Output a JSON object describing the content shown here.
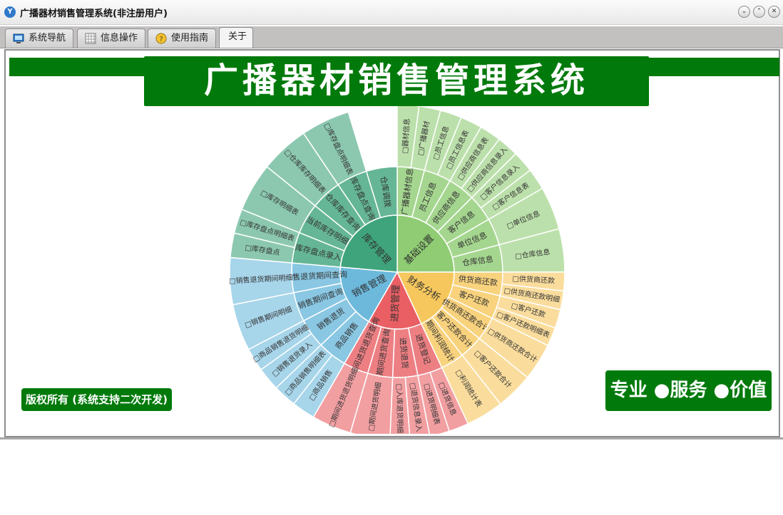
{
  "window": {
    "title": "广播器材销售管理系统(非注册用户)",
    "controls": [
      "minimize",
      "restore",
      "close"
    ]
  },
  "tabs": [
    {
      "label": "系统导航",
      "icon": "monitor-icon"
    },
    {
      "label": "信息操作",
      "icon": "grid-icon"
    },
    {
      "label": "使用指南",
      "icon": "help-icon"
    },
    {
      "label": "关于",
      "icon": ""
    }
  ],
  "active_tab": "关于",
  "banner": {
    "title": "广播器材销售管理系统"
  },
  "copyright": "版权所有 (系统支持二次开发)",
  "slogan": "专业 ●服务 ●价值",
  "colors": {
    "brand_green": "#017a0b"
  },
  "wheel": {
    "sectors": [
      {
        "name": "基础设置",
        "color": "#8fcc73",
        "children": [
          {
            "label": "广播器材信息",
            "leaves": [
              "□器材信息",
              "□广播器材"
            ]
          },
          {
            "label": "员工信息",
            "leaves": [
              "□员工信息",
              "□员工信息表"
            ]
          },
          {
            "label": "供应商信息",
            "leaves": [
              "□供应商信息表",
              "□供应商信息录入"
            ]
          },
          {
            "label": "客户信息",
            "leaves": [
              "□客户信息录入",
              "□客户信息表"
            ]
          },
          {
            "label": "单位信息",
            "leaves": [
              "□单位信息"
            ]
          },
          {
            "label": "仓库信息",
            "leaves": [
              "□仓库信息"
            ]
          }
        ]
      },
      {
        "name": "财务分析",
        "color": "#f6c75c",
        "children": [
          {
            "label": "供货商还款",
            "leaves": [
              "□供货商还款",
              "□供货商还款明细"
            ]
          },
          {
            "label": "客户还款",
            "leaves": [
              "□客户还款",
              "□客户还款明细表"
            ]
          },
          {
            "label": "供货商还款合计",
            "leaves": [
              "□供货商还款合计"
            ]
          },
          {
            "label": "客户还款合计",
            "leaves": [
              "□客户还款合计"
            ]
          },
          {
            "label": "期间利润统计",
            "leaves": [
              "□利润统计表"
            ]
          }
        ]
      },
      {
        "name": "进货管理",
        "color": "#e95f64",
        "children": [
          {
            "label": "进货登记",
            "leaves": [
              "□进货信息",
              "□进货明细表"
            ]
          },
          {
            "label": "进货退货",
            "leaves": [
              "□退货信息录入",
              "□入库退货明细"
            ]
          },
          {
            "label": "期间进货查询",
            "leaves": [
              "□期间进货明细"
            ]
          },
          {
            "label": "期间进货退货查询",
            "leaves": [
              "□期间进货退货明细"
            ]
          }
        ]
      },
      {
        "name": "销售管理",
        "color": "#6cb9dc",
        "children": [
          {
            "label": "商品销售",
            "leaves": [
              "□商品销售",
              "□商品销售明细表"
            ]
          },
          {
            "label": "销售退货",
            "leaves": [
              "□销售退货录入",
              "□商品销售退货明细"
            ]
          },
          {
            "label": "销售期间查询",
            "leaves": [
              "□销售期间明细"
            ]
          },
          {
            "label": "销售退货期间查询",
            "leaves": [
              "□销售退货期间明细"
            ]
          }
        ]
      },
      {
        "name": "库存管理",
        "color": "#3fa47c",
        "children": [
          {
            "label": "库存盘点录入",
            "leaves": [
              "□库存盘点",
              "□库存盘点明细表"
            ]
          },
          {
            "label": "当前库存明细",
            "leaves": [
              "□库存明细表"
            ]
          },
          {
            "label": "仓库库存查询",
            "leaves": [
              "□仓库库存明细表"
            ]
          },
          {
            "label": "库存盘点查询",
            "leaves": [
              "□库存盘点明细表"
            ]
          },
          {
            "label": "仓库调拨",
            "leaves": []
          }
        ]
      }
    ]
  }
}
